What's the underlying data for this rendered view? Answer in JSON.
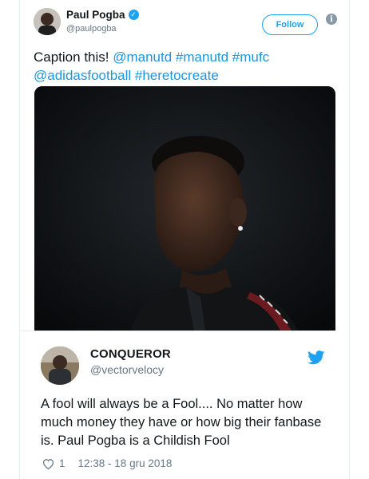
{
  "tweet": {
    "author_name": "Paul Pogba",
    "author_handle": "@paulpogba",
    "follow_label": "Follow",
    "text_plain": "Caption this! ",
    "text_links_line1": "@manutd #manutd #mufc",
    "text_links_line2": "@adidasfootball #heretocreate"
  },
  "reply": {
    "author_name": "CONQUEROR",
    "author_handle": "@vectorvelocy",
    "text": "A fool will always be a Fool.... No matter how much money they have or how big their fanbase is. Paul Pogba is a Childish Fool",
    "likes": "1",
    "timestamp": "12:38 - 18 gru 2018"
  },
  "icons": {
    "verified": "verified-badge-icon",
    "info": "info-icon",
    "bird": "twitter-bird-icon",
    "like": "heart-icon"
  },
  "colors": {
    "accent": "#1da1f2",
    "link": "#1b95e0",
    "muted": "#657786"
  }
}
